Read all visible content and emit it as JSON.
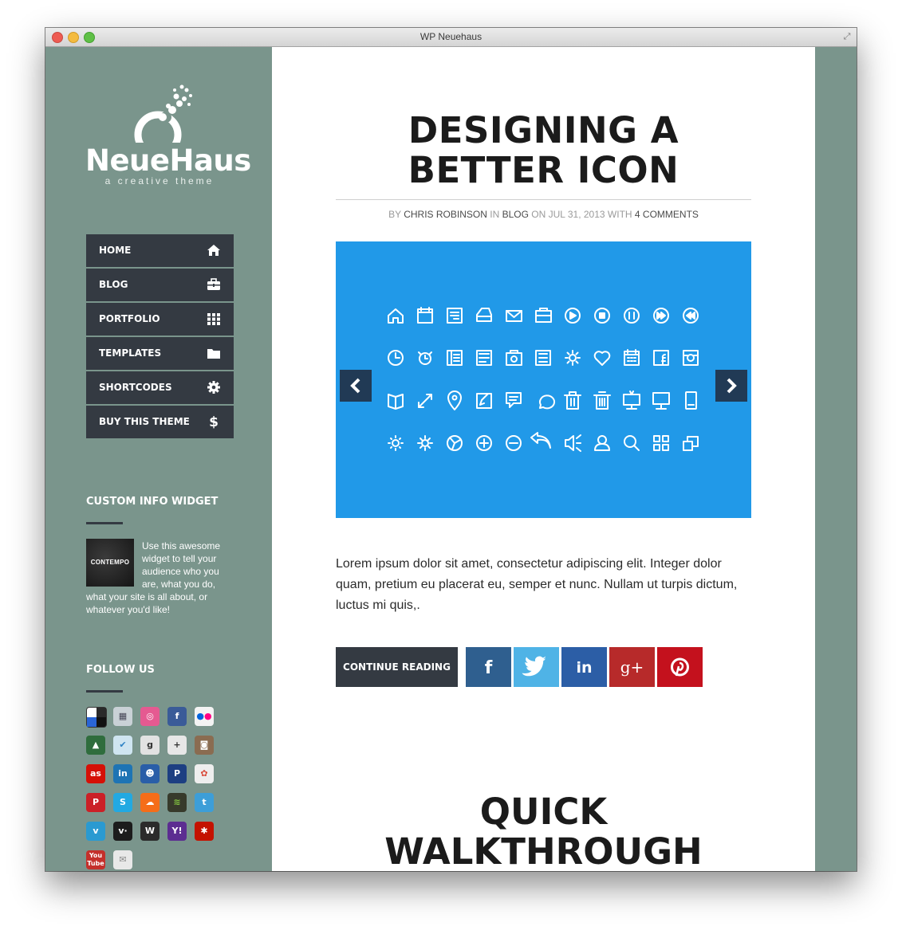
{
  "window": {
    "title": "WP Neuehaus"
  },
  "logo": {
    "name": "NeueHaus",
    "tagline": "a creative theme"
  },
  "nav": [
    {
      "label": "HOME",
      "icon": "home-icon"
    },
    {
      "label": "BLOG",
      "icon": "briefcase-icon"
    },
    {
      "label": "PORTFOLIO",
      "icon": "grid-icon"
    },
    {
      "label": "TEMPLATES",
      "icon": "folder-icon"
    },
    {
      "label": "SHORTCODES",
      "icon": "gear-icon"
    },
    {
      "label": "BUY THIS THEME",
      "icon": "dollar-icon"
    }
  ],
  "info_widget": {
    "title": "CUSTOM INFO WIDGET",
    "image_label": "CONTEMPO",
    "text": "Use this awesome widget to tell your audience who you are, what you do, what your site is all about, or whatever you'd like!"
  },
  "follow": {
    "title": "FOLLOW US",
    "icons": [
      "delicious-icon",
      "digg-icon",
      "dribbble-icon",
      "facebook-icon",
      "flickr-icon",
      "forrst-icon",
      "foursquare-icon",
      "google-icon",
      "google-plus-icon",
      "instagram-icon",
      "lastfm-icon",
      "linkedin-icon",
      "myspace-icon",
      "paypal-icon",
      "picasa-icon",
      "pinterest-icon",
      "skype-icon",
      "soundcloud-icon",
      "spotify-icon",
      "twitter-icon",
      "vimeo-icon",
      "vine-icon",
      "wordpress-icon",
      "yahoo-icon",
      "yelp-icon",
      "youtube-icon",
      "email-icon"
    ]
  },
  "post": {
    "title": "DESIGNING A BETTER ICON",
    "meta": {
      "by": "BY",
      "author": "CHRIS ROBINSON",
      "in": "IN",
      "category": "BLOG",
      "on": "ON JUL 31, 2013 WITH",
      "comments": "4 COMMENTS"
    },
    "excerpt": "Lorem ipsum dolor sit amet, consectetur adipiscing elit. Integer dolor quam, pretium eu placerat eu, semper et nunc. Nullam ut turpis dictum, luctus mi quis,.",
    "continue_label": "CONTINUE READING",
    "share": [
      {
        "name": "facebook-share-button",
        "glyph": "f",
        "color": "#2f5f8f"
      },
      {
        "name": "twitter-share-button",
        "glyph": "t",
        "color": "#4fb3e6"
      },
      {
        "name": "linkedin-share-button",
        "glyph": "in",
        "color": "#2c5ea6"
      },
      {
        "name": "google-plus-share-button",
        "glyph": "g+",
        "color": "#b72a2a"
      },
      {
        "name": "pinterest-share-button",
        "glyph": "p",
        "color": "#c4111d"
      }
    ]
  },
  "next_section": {
    "title": "QUICK WALKTHROUGH"
  },
  "colors": {
    "sidebar": "#7a958c",
    "nav": "#343a42",
    "slider": "#2199e8",
    "arrow": "#213a55"
  }
}
